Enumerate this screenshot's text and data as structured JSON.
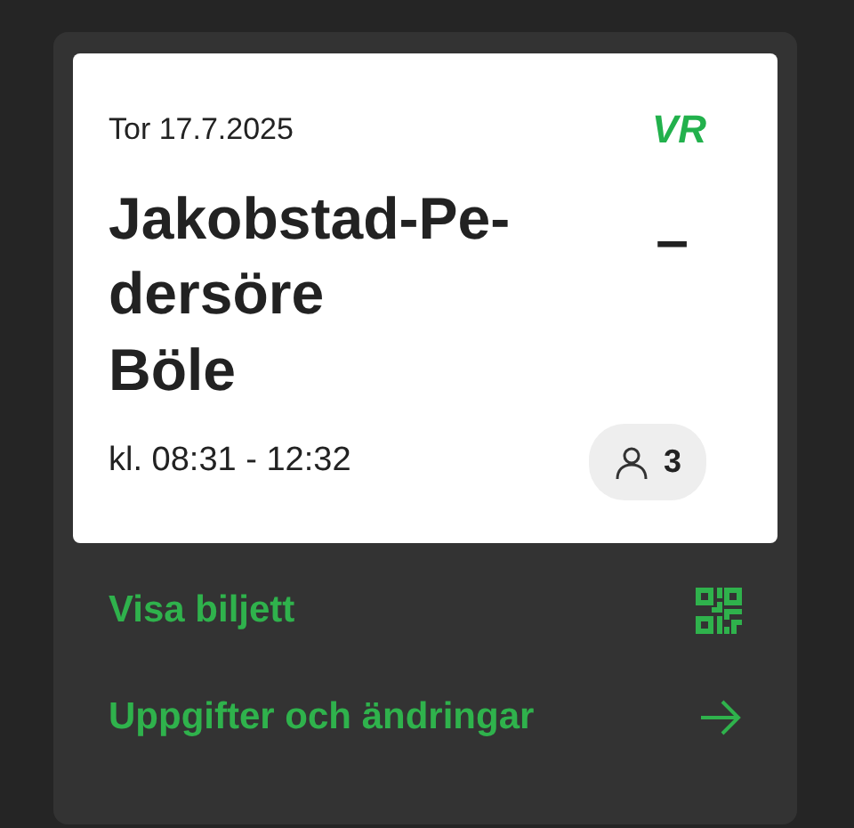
{
  "ticket": {
    "date": "Tor 17.7.2025",
    "logo": "VR",
    "origin": "Jakobstad-Pe-\ndersöre",
    "separator": "–",
    "destination": "Böle",
    "time": "kl. 08:31 - 12:32",
    "passengers": "3"
  },
  "actions": [
    {
      "label": "Visa biljett",
      "kind": "qr"
    },
    {
      "label": "Uppgifter och ändringar",
      "kind": "arrow"
    }
  ]
}
